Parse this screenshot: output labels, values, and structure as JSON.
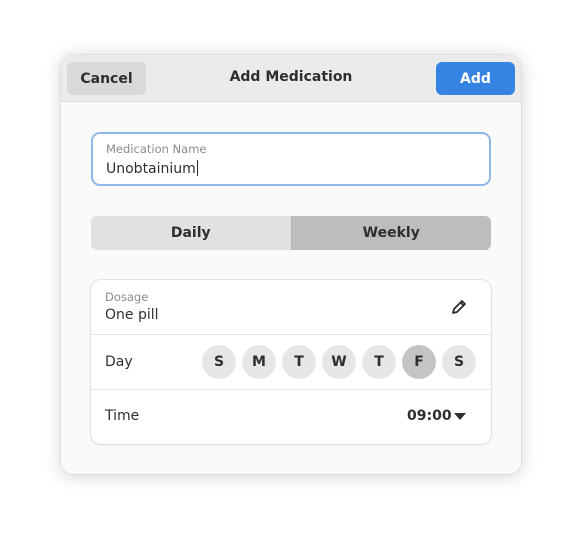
{
  "header": {
    "title": "Add Medication",
    "cancel_label": "Cancel",
    "add_label": "Add"
  },
  "name_field": {
    "label": "Medication Name",
    "value": "Unobtainium"
  },
  "frequency": {
    "options": [
      "Daily",
      "Weekly"
    ],
    "selected": "Weekly"
  },
  "dosage": {
    "label": "Dosage",
    "value": "One pill",
    "edit_icon": "pencil-icon"
  },
  "day": {
    "label": "Day",
    "days": [
      "S",
      "M",
      "T",
      "W",
      "T",
      "F",
      "S"
    ],
    "selected_index": 5
  },
  "time": {
    "label": "Time",
    "value": "09:00",
    "dropdown_icon": "chevron-down-icon"
  },
  "colors": {
    "accent": "#3584e4",
    "focus_border": "#8fb7ea",
    "selected_toggle": "#bdbdbd",
    "selected_day": "#c4c4c4"
  }
}
